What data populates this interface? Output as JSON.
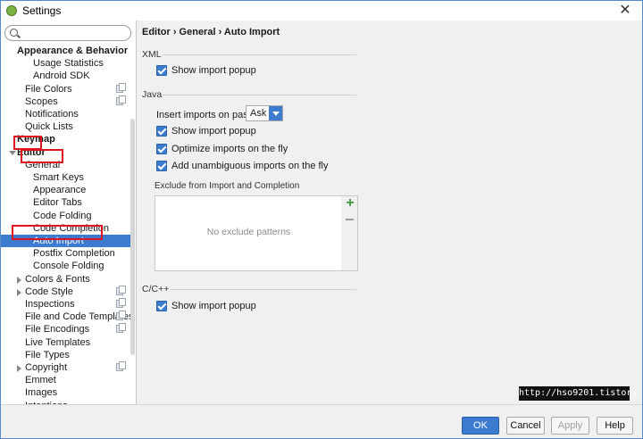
{
  "window": {
    "title": "Settings",
    "close_glyph": "✕",
    "icon": "intellij-app-icon"
  },
  "search": {
    "value": "",
    "placeholder": ""
  },
  "tree": [
    {
      "label": "Appearance & Behavior",
      "level": 0,
      "bold": true
    },
    {
      "label": "Usage Statistics",
      "level": 2
    },
    {
      "label": "Android SDK",
      "level": 2
    },
    {
      "label": "File Colors",
      "level": 1,
      "project_icon": true
    },
    {
      "label": "Scopes",
      "level": 1,
      "project_icon": true
    },
    {
      "label": "Notifications",
      "level": 1
    },
    {
      "label": "Quick Lists",
      "level": 1
    },
    {
      "label": "Keymap",
      "level": 0,
      "bold": true
    },
    {
      "label": "Editor",
      "level": 0,
      "bold": true,
      "expanded": true
    },
    {
      "label": "General",
      "level": 1,
      "expanded": true
    },
    {
      "label": "Smart Keys",
      "level": 2
    },
    {
      "label": "Appearance",
      "level": 2
    },
    {
      "label": "Editor Tabs",
      "level": 2
    },
    {
      "label": "Code Folding",
      "level": 2
    },
    {
      "label": "Code Completion",
      "level": 2
    },
    {
      "label": "Auto Import",
      "level": 2,
      "selected": true
    },
    {
      "label": "Postfix Completion",
      "level": 2
    },
    {
      "label": "Console Folding",
      "level": 2
    },
    {
      "label": "Colors & Fonts",
      "level": 1,
      "collapsed": true
    },
    {
      "label": "Code Style",
      "level": 1,
      "collapsed": true,
      "project_icon": true
    },
    {
      "label": "Inspections",
      "level": 1,
      "project_icon": true
    },
    {
      "label": "File and Code Templates",
      "level": 1,
      "project_icon": true
    },
    {
      "label": "File Encodings",
      "level": 1,
      "project_icon": true
    },
    {
      "label": "Live Templates",
      "level": 1
    },
    {
      "label": "File Types",
      "level": 1
    },
    {
      "label": "Copyright",
      "level": 1,
      "collapsed": true,
      "project_icon": true
    },
    {
      "label": "Emmet",
      "level": 1
    },
    {
      "label": "Images",
      "level": 1
    },
    {
      "label": "Intentions",
      "level": 1
    }
  ],
  "content": {
    "breadcrumb": "Editor › General › Auto Import",
    "xml": {
      "section": "XML",
      "show_popup": {
        "label": "Show import popup",
        "checked": true
      }
    },
    "java": {
      "section": "Java",
      "insert_label": "Insert imports on paste:",
      "insert_value": "Ask",
      "show_popup": {
        "label": "Show import popup",
        "checked": true
      },
      "optimize": {
        "label": "Optimize imports on the fly",
        "checked": true
      },
      "unambiguous": {
        "label": "Add unambiguous imports on the fly",
        "checked": true
      },
      "exclude_title": "Exclude from Import and Completion",
      "exclude_empty": "No exclude patterns",
      "add_icon": "plus-icon",
      "remove_icon": "minus-icon"
    },
    "cpp": {
      "section": "C/C++",
      "show_popup": {
        "label": "Show import popup",
        "checked": true
      }
    }
  },
  "watermark": "http://hso9201.tistory.com",
  "buttons": {
    "ok": "OK",
    "cancel": "Cancel",
    "apply": "Apply",
    "help": "Help"
  },
  "colors": {
    "accent": "#3d7bd1",
    "highlight": "#e0141e"
  }
}
